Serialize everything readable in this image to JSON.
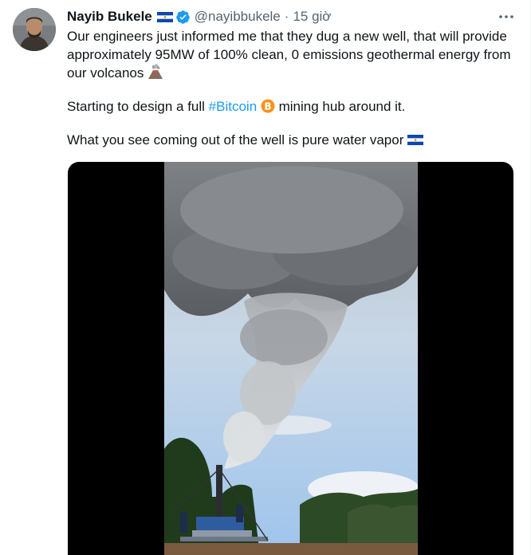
{
  "tweet": {
    "author_name": "Nayib Bukele",
    "handle": "@nayibbukele",
    "separator": "·",
    "timestamp": "15 giờ",
    "paragraphs": {
      "p1": "Our engineers just informed me that they dug a new well, that will provide approximately 95MW of 100% clean, 0 emissions geothermal energy from our volcanos",
      "p2_before": "Starting to design a full ",
      "p2_hashtag": "#Bitcoin",
      "p2_after": " mining hub around it.",
      "p3": "What you see coming out of the well is pure water vapor"
    }
  },
  "icons": {
    "flag": "el-salvador-flag-icon",
    "verified": "verified-badge-icon",
    "more": "more-options-icon",
    "volcano": "volcano-emoji-icon",
    "bitcoin": "bitcoin-emoji-icon"
  },
  "colors": {
    "text": "#0f1419",
    "secondary": "#536471",
    "link": "#1d9bf0",
    "verified": "#1d9bf0",
    "media_background": "#000000"
  }
}
